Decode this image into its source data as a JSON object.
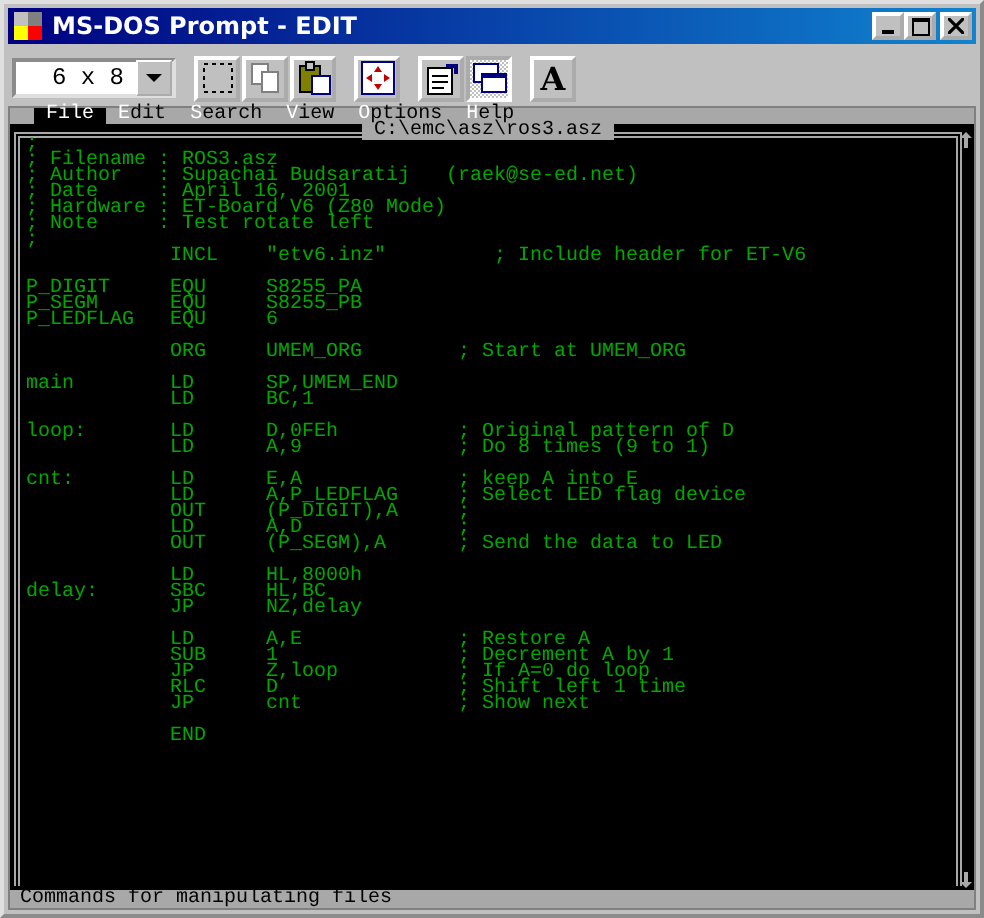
{
  "window": {
    "title": "MS-DOS Prompt - EDIT"
  },
  "toolbar": {
    "font_size": "6 x 8",
    "buttons": [
      {
        "kind": "mark",
        "pressed": false
      },
      {
        "kind": "copy",
        "pressed": false
      },
      {
        "kind": "paste",
        "pressed": false
      },
      {
        "kind": "fullscreen",
        "pressed": false
      },
      {
        "kind": "properties",
        "pressed": false
      },
      {
        "kind": "background",
        "pressed": true
      },
      {
        "kind": "font",
        "label": "A",
        "pressed": false
      }
    ]
  },
  "menu": [
    {
      "label": "File",
      "selected": true
    },
    {
      "label": "Edit",
      "selected": false
    },
    {
      "label": "Search",
      "selected": false
    },
    {
      "label": "View",
      "selected": false
    },
    {
      "label": "Options",
      "selected": false
    },
    {
      "label": "Help",
      "selected": false
    }
  ],
  "file_path": "C:\\emc\\asz\\ros3.asz",
  "code_blocks": [
    [
      ";",
      "; Filename : ROS3.asz",
      "; Author   : Supachai Budsaratij   (raek@se-ed.net)",
      "; Date     : April 16, 2001",
      "; Hardware : ET-Board V6 (Z80 Mode)",
      "; Note     : Test rotate left",
      ";",
      "            INCL    \"etv6.inz\"         ; Include header for ET-V6"
    ],
    [
      "P_DIGIT     EQU     S8255_PA",
      "P_SEGM      EQU     S8255_PB",
      "P_LEDFLAG   EQU     6"
    ],
    [
      "            ORG     UMEM_ORG        ; Start at UMEM_ORG"
    ],
    [
      "main        LD      SP,UMEM_END",
      "            LD      BC,1"
    ],
    [
      "loop:       LD      D,0FEh          ; Original pattern of D",
      "            LD      A,9             ; Do 8 times (9 to 1)"
    ],
    [
      "cnt:        LD      E,A             ; keep A into E",
      "            LD      A,P_LEDFLAG     ; Select LED flag device",
      "            OUT     (P_DIGIT),A     ;",
      "            LD      A,D             ;",
      "            OUT     (P_SEGM),A      ; Send the data to LED"
    ],
    [
      "            LD      HL,8000h",
      "delay:      SBC     HL,BC",
      "            JP      NZ,delay"
    ],
    [
      "            LD      A,E             ; Restore A",
      "            SUB     1               ; Decrement A by 1",
      "            JP      Z,loop          ; If A=0 do loop",
      "            RLC     D               ; Shift left 1 time",
      "            JP      cnt             ; Show next"
    ],
    [
      "            END"
    ]
  ],
  "status_bar": "Commands for manipulating files"
}
